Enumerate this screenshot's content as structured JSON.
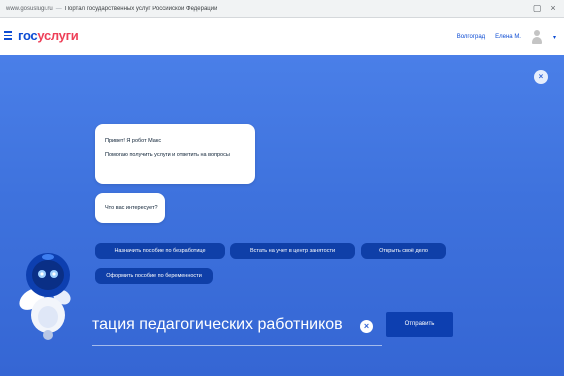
{
  "browser": {
    "url": "www.gosuslugi.ru",
    "page_title": "Портал государственных услуг Российской Федерации",
    "icons": [
      "tab-icon",
      "close-icon"
    ]
  },
  "header": {
    "logo_part1": "гос",
    "logo_part2": "услуги",
    "region_link": "Волгоград",
    "user_name": "Елена М.",
    "icons": [
      "menu-icon",
      "avatar-icon",
      "chevron-down-icon"
    ]
  },
  "chat": {
    "greeting": "Привет! Я робот Макс",
    "intro": "Помогаю получить услуги и ответить на вопросы",
    "question": "Что вас интересует?",
    "chips": [
      "Назначить пособие по безработице",
      "Встать на учет в центр занятости",
      "Открыть своё дело",
      "Оформить пособие по беременности"
    ],
    "close_icon": "close-icon"
  },
  "input": {
    "value": "тация педагогических работников",
    "send_label": "Отправить",
    "clear_icon": "clear-icon"
  },
  "colors": {
    "brand_blue": "#0d4cd3",
    "brand_red": "#ee3f58",
    "background": "#3c6fd9",
    "chip": "#0f3fa8"
  }
}
